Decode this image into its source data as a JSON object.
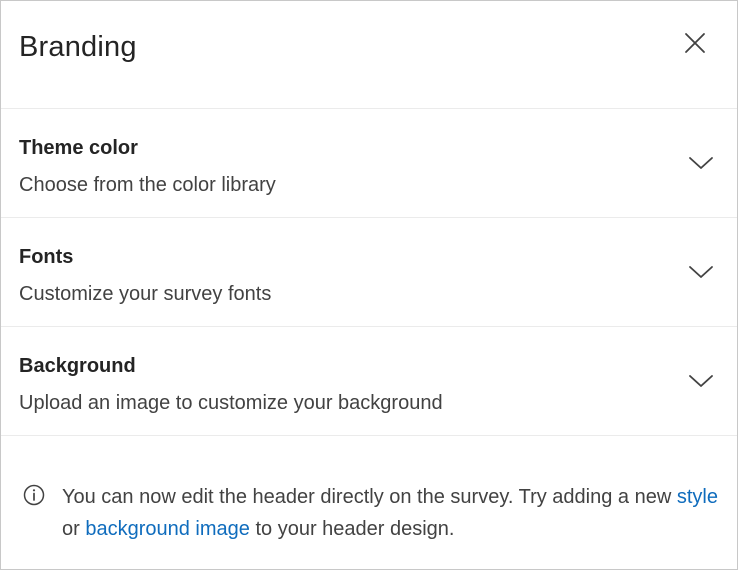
{
  "panel": {
    "title": "Branding",
    "close_icon": "close-icon"
  },
  "sections": [
    {
      "title": "Theme color",
      "subtitle": "Choose from the color library",
      "icon": "chevron-down-icon"
    },
    {
      "title": "Fonts",
      "subtitle": "Customize your survey fonts",
      "icon": "chevron-down-icon"
    },
    {
      "title": "Background",
      "subtitle": "Upload an image to customize your background",
      "icon": "chevron-down-icon"
    }
  ],
  "info": {
    "icon": "info-icon",
    "text_before": "You can now edit the header directly on the survey. Try adding a new ",
    "link_style": "style",
    "text_middle": " or ",
    "link_background": "background image",
    "text_after": " to your header design."
  },
  "colors": {
    "text": "#242424",
    "subtext": "#424242",
    "link": "#0f6cbd",
    "divider": "#ebebeb",
    "border": "#c8c8c8"
  }
}
